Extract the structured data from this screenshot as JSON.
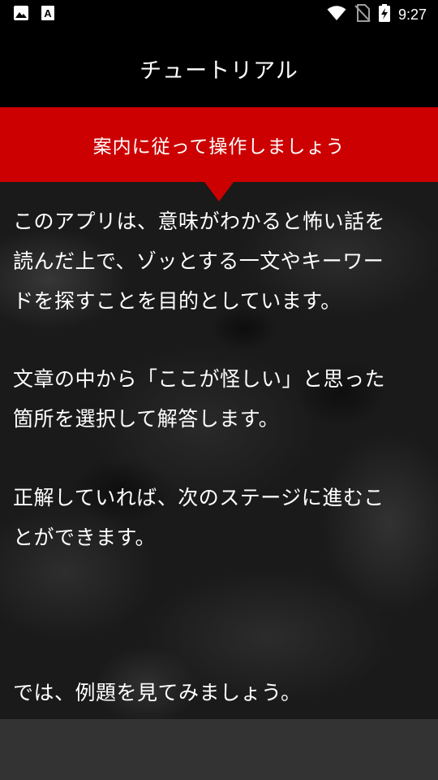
{
  "status_bar": {
    "time": "9:27",
    "left_icons": [
      "image-icon",
      "font-icon"
    ],
    "right_icons": [
      "wifi-icon",
      "no-sim-icon",
      "battery-charging-icon"
    ]
  },
  "app_bar": {
    "title": "チュートリアル"
  },
  "banner": {
    "text": "案内に従って操作しましょう",
    "color": "#cc0000"
  },
  "content": {
    "paragraphs": [
      {
        "lines": [
          "このアプリは、意味がわかると怖い話を",
          "読んだ上で、ゾッとする一文やキーワー",
          "ドを探すことを目的としています。"
        ]
      },
      {
        "lines": [
          "文章の中から「ここが怪しい」と思った",
          "箇所を選択して解答します。"
        ]
      },
      {
        "lines": [
          "正解していれば、次のステージに進むこ",
          "とができます。"
        ]
      },
      {
        "lines": [
          "では、例題を見てみましょう。"
        ]
      }
    ]
  }
}
